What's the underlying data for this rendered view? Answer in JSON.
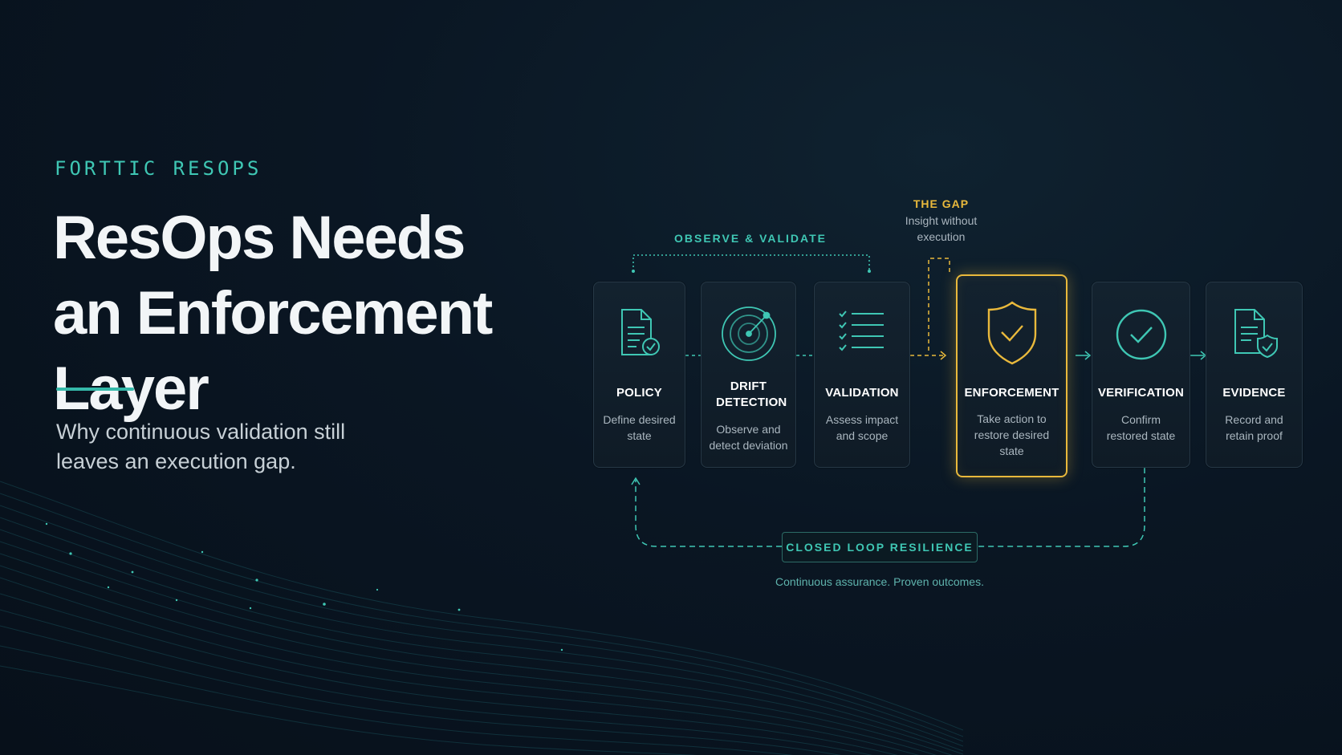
{
  "brand": "FORTTIC RESOPS",
  "headline": {
    "line1": "ResOps Needs",
    "line2": "an Enforcement Layer"
  },
  "subtitle": "Why continuous validation still leaves an execution gap.",
  "observe_label": "OBSERVE & VALIDATE",
  "gap": {
    "title": "THE GAP",
    "description": "Insight without execution"
  },
  "steps": [
    {
      "title": "POLICY",
      "description": "Define desired state",
      "icon": "policy-document-icon"
    },
    {
      "title": "DRIFT DETECTION",
      "description": "Observe and detect deviation",
      "icon": "radar-icon"
    },
    {
      "title": "VALIDATION",
      "description": "Assess impact and scope",
      "icon": "checklist-icon"
    },
    {
      "title": "ENFORCEMENT",
      "description": "Take action to restore desired state",
      "icon": "shield-check-icon"
    },
    {
      "title": "VERIFICATION",
      "description": "Confirm restored state",
      "icon": "check-circle-icon"
    },
    {
      "title": "EVIDENCE",
      "description": "Record and retain proof",
      "icon": "document-shield-icon"
    }
  ],
  "loop": {
    "label": "CLOSED LOOP RESILIENCE",
    "caption": "Continuous assurance. Proven outcomes."
  },
  "colors": {
    "accent": "#3fc7b4",
    "highlight": "#e9b93c",
    "background": "#0a1623"
  }
}
